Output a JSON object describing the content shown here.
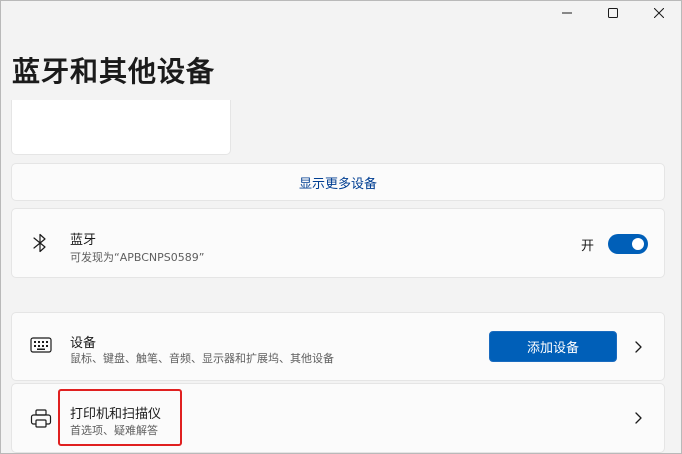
{
  "window": {
    "minimize_icon": "minimize-icon",
    "maximize_icon": "maximize-icon",
    "close_icon": "close-icon"
  },
  "page": {
    "title": "蓝牙和其他设备",
    "show_more": "显示更多设备"
  },
  "bluetooth": {
    "icon": "bluetooth-icon",
    "title": "蓝牙",
    "subtitle": "可发现为“APBCNPS0589”",
    "toggle_label": "开",
    "toggle_state": "on"
  },
  "devices": {
    "icon": "keyboard-icon",
    "title": "设备",
    "subtitle": "鼠标、键盘、触笔、音频、显示器和扩展坞、其他设备",
    "add_button": "添加设备"
  },
  "printers": {
    "icon": "printer-icon",
    "title": "打印机和扫描仪",
    "subtitle": "首选项、疑难解答"
  },
  "colors": {
    "accent": "#005fb8",
    "highlight": "#e02020"
  }
}
